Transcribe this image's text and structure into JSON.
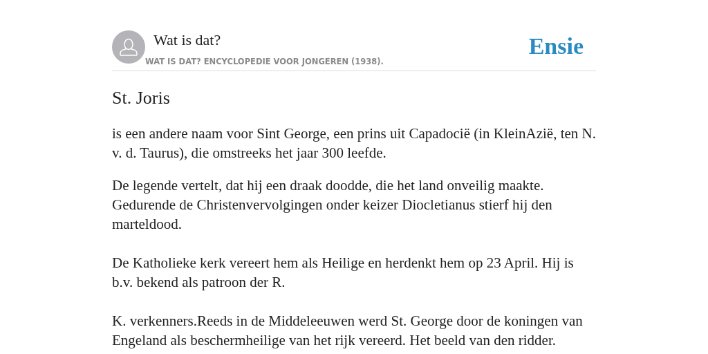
{
  "header": {
    "site_title": "Wat is dat?",
    "source": "WAT IS DAT? ENCYCLOPEDIE VOOR JONGEREN (1938).",
    "logo": "Ensie"
  },
  "article": {
    "title": "St. Joris",
    "paragraphs": [
      "is een andere naam voor Sint George, een prins uit Capadocië (in KleinAzië, ten N. v. d. Taurus), die omstreeks het jaar 300 leefde.",
      "De legende vertelt, dat hij een draak doodde, die het land onveilig maakte. Gedurende de Christenvervolgingen onder keizer Diocletianus stierf hij den marteldood.",
      "De Katholieke kerk vereert hem als Heilige en herdenkt hem op 23 April. Hij is b.v. bekend als patroon der R.",
      "K. verkenners.Reeds in de Middeleeuwen werd St. George door de koningen van Engeland als beschermheilige van het rijk vereerd. Het beeld van den ridder."
    ]
  }
}
